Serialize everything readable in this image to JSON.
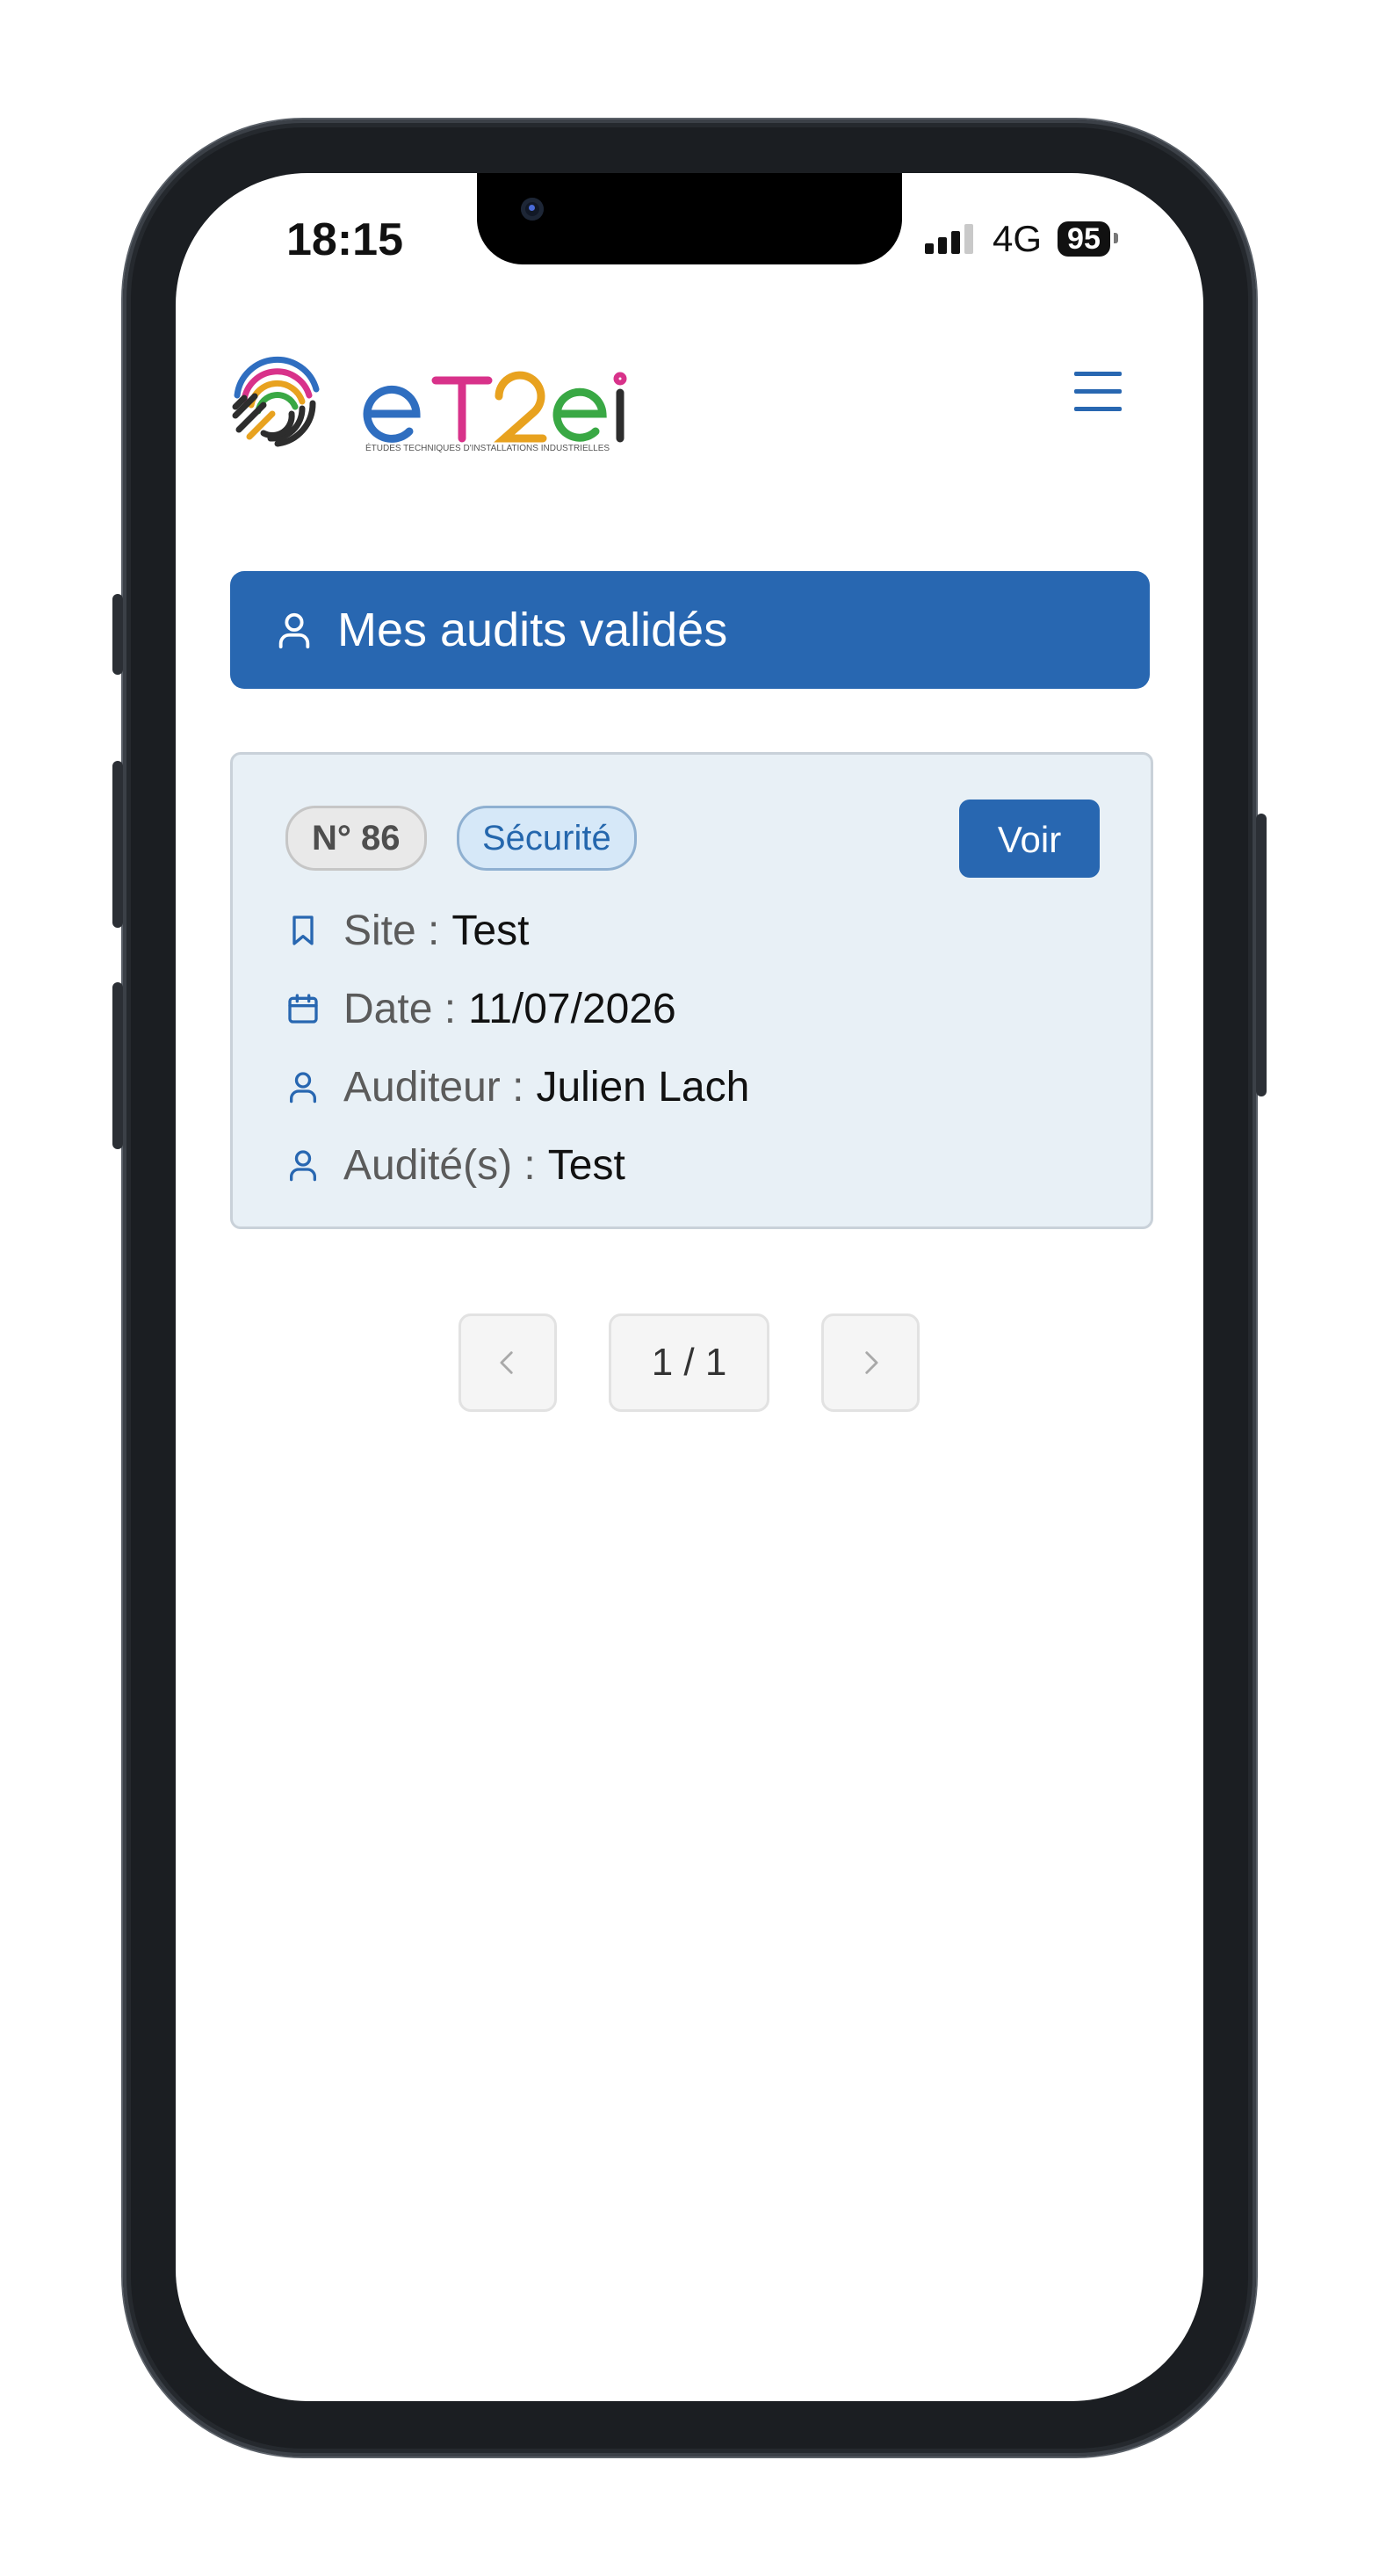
{
  "status_bar": {
    "time": "18:15",
    "network": "4G",
    "battery": "95"
  },
  "header": {
    "logo_wordmark": "eTeI",
    "logo_tagline": "ÉTUDES TECHNIQUES D'INSTALLATIONS INDUSTRIELLES",
    "menu_icon": "hamburger-menu-icon"
  },
  "page": {
    "title": "Mes audits validés",
    "title_icon": "user-icon"
  },
  "audits": [
    {
      "number": "N° 86",
      "category": "Sécurité",
      "action_label": "Voir",
      "fields": {
        "site_label": "Site :",
        "site_value": "Test",
        "date_label": "Date :",
        "date_value": "11/07/2026",
        "auditor_label": "Auditeur :",
        "auditor_value": "Julien Lach",
        "audited_label": "Audité(s) :",
        "audited_value": "Test"
      }
    }
  ],
  "pagination": {
    "current": "1 / 1",
    "prev_icon": "chevron-left-icon",
    "next_icon": "chevron-right-icon"
  },
  "colors": {
    "primary": "#2867b1",
    "card_bg": "#e8f0f6",
    "category_badge_bg": "#d6e8f8",
    "number_badge_bg": "#e9e9e9"
  }
}
